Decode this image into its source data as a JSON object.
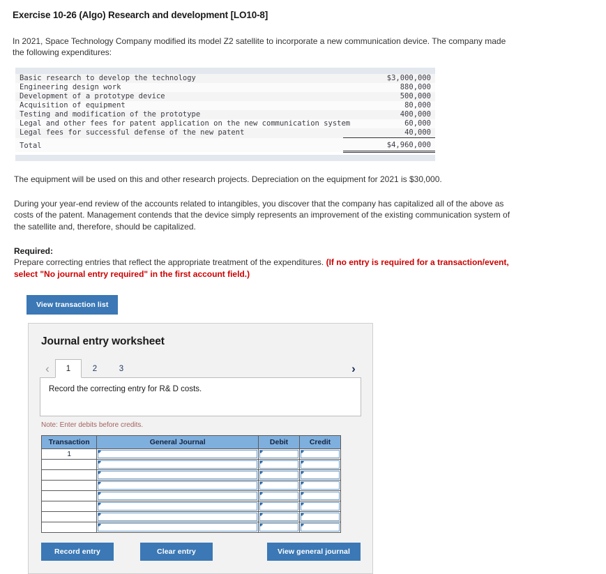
{
  "exercise": {
    "title": "Exercise 10-26 (Algo) Research and development [LO10-8]",
    "intro": "In 2021, Space Technology Company modified its model Z2 satellite to incorporate a new communication device. The company made the following expenditures:"
  },
  "expenditures": {
    "rows": [
      {
        "label": "Basic research to develop the technology",
        "amount": "$3,000,000"
      },
      {
        "label": "Engineering design work",
        "amount": "880,000"
      },
      {
        "label": "Development of a prototype device",
        "amount": "500,000"
      },
      {
        "label": "Acquisition of equipment",
        "amount": "80,000"
      },
      {
        "label": "Testing and modification of the prototype",
        "amount": "400,000"
      },
      {
        "label": "Legal and other fees for patent application on the new communication system",
        "amount": "60,000"
      },
      {
        "label": "Legal fees for successful defense of the new patent",
        "amount": "40,000"
      }
    ],
    "total_label": "Total",
    "total_amount": "$4,960,000"
  },
  "body": {
    "para1": "The equipment will be used on this and other research projects. Depreciation on the equipment for 2021 is $30,000.",
    "para2": "During your year-end review of the accounts related to intangibles, you discover that the company has capitalized all of the above as costs of the patent. Management contends that the device simply represents an improvement of the existing communication system of the satellite and, therefore, should be capitalized.",
    "required_heading": "Required:",
    "required_text": "Prepare correcting entries that reflect the appropriate treatment of the expenditures. ",
    "required_emphasis": "(If no entry is required for a transaction/event, select \"No journal entry required\" in the first account field.)"
  },
  "toolbar": {
    "view_transaction_list_label": "View transaction list"
  },
  "worksheet": {
    "title": "Journal entry worksheet",
    "prev_icon": "chevron-left-icon",
    "next_icon": "chevron-right-icon",
    "tabs": [
      {
        "label": "1",
        "active": true
      },
      {
        "label": "2",
        "active": false
      },
      {
        "label": "3",
        "active": false
      }
    ],
    "instruction": "Record the correcting entry for R& D costs.",
    "note": "Note: Enter debits before credits.",
    "table": {
      "headers": [
        "Transaction",
        "General Journal",
        "Debit",
        "Credit"
      ],
      "rows": [
        {
          "transaction": "1",
          "general_journal": "",
          "debit": "",
          "credit": ""
        },
        {
          "transaction": "",
          "general_journal": "",
          "debit": "",
          "credit": ""
        },
        {
          "transaction": "",
          "general_journal": "",
          "debit": "",
          "credit": ""
        },
        {
          "transaction": "",
          "general_journal": "",
          "debit": "",
          "credit": ""
        },
        {
          "transaction": "",
          "general_journal": "",
          "debit": "",
          "credit": ""
        },
        {
          "transaction": "",
          "general_journal": "",
          "debit": "",
          "credit": ""
        },
        {
          "transaction": "",
          "general_journal": "",
          "debit": "",
          "credit": ""
        },
        {
          "transaction": "",
          "general_journal": "",
          "debit": "",
          "credit": ""
        }
      ]
    },
    "buttons": {
      "record_entry": "Record entry",
      "clear_entry": "Clear entry",
      "view_general_journal": "View general journal"
    }
  },
  "colors": {
    "button_blue": "#3b78b5",
    "table_header_blue": "#7fafdd",
    "accent_red": "#cc0000",
    "note_red": "#a4615f",
    "panel_gray": "#f2f2f2"
  }
}
